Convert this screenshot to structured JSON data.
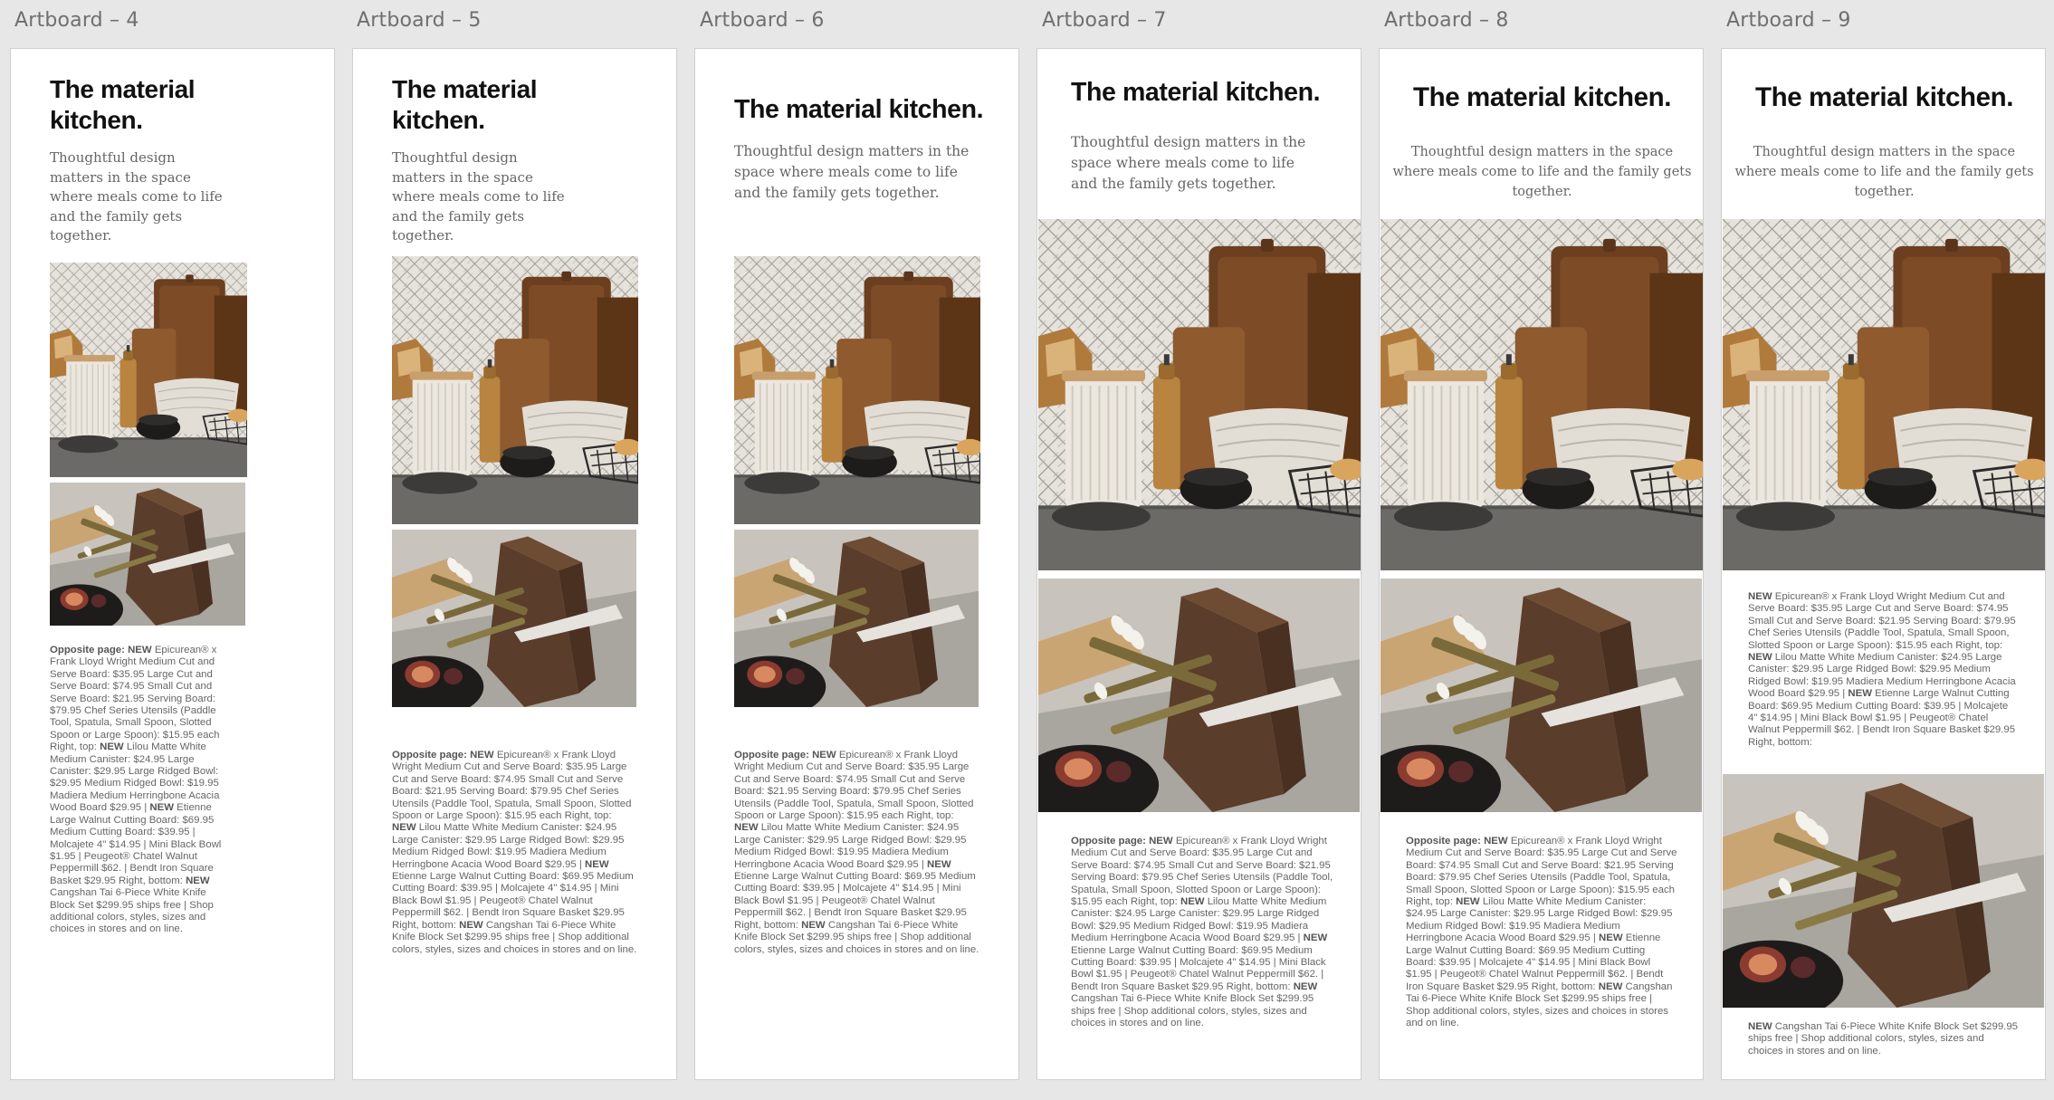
{
  "artboards": [
    {
      "label": "Artboard – 4"
    },
    {
      "label": "Artboard – 5"
    },
    {
      "label": "Artboard – 6"
    },
    {
      "label": "Artboard – 7"
    },
    {
      "label": "Artboard – 8"
    },
    {
      "label": "Artboard – 9"
    }
  ],
  "content": {
    "title": "The material kitchen.",
    "subtitle": "Thoughtful design matters in the space where meals come to life and the family gets together.",
    "caption": {
      "bold_opposite": "Opposite page:",
      "bold_new": "NEW",
      "part1": "Epicurean® x Frank Lloyd Wright Medium Cut and Serve Board: $35.95 Large Cut and Serve Board: $74.95 Small Cut and Serve Board: $21.95 Serving Board: $79.95 Chef Series Utensils (Paddle Tool, Spatula, Small Spoon, Slotted Spoon or Large Spoon): $15.95 each Right, top:",
      "part2": "Lilou Matte White Medium Canister: $24.95 Large Canister: $29.95 Large Ridged Bowl: $29.95 Medium Ridged Bowl: $19.95 Madiera Medium Herringbone Acacia Wood Board $29.95 |",
      "part3": "Etienne Large Walnut Cutting Board: $69.95 Medium Cutting Board: $39.95 | Molcajete 4\" $14.95 | Mini Black Bowl $1.95 | Peugeot® Chatel Walnut Peppermill $62. | Bendt Iron Square Basket $29.95 Right, bottom:",
      "part4": "Cangshan Tai 6-Piece White Knife Block Set $299.95 ships free | Shop additional colors, styles, sizes and choices in stores and on line."
    }
  }
}
